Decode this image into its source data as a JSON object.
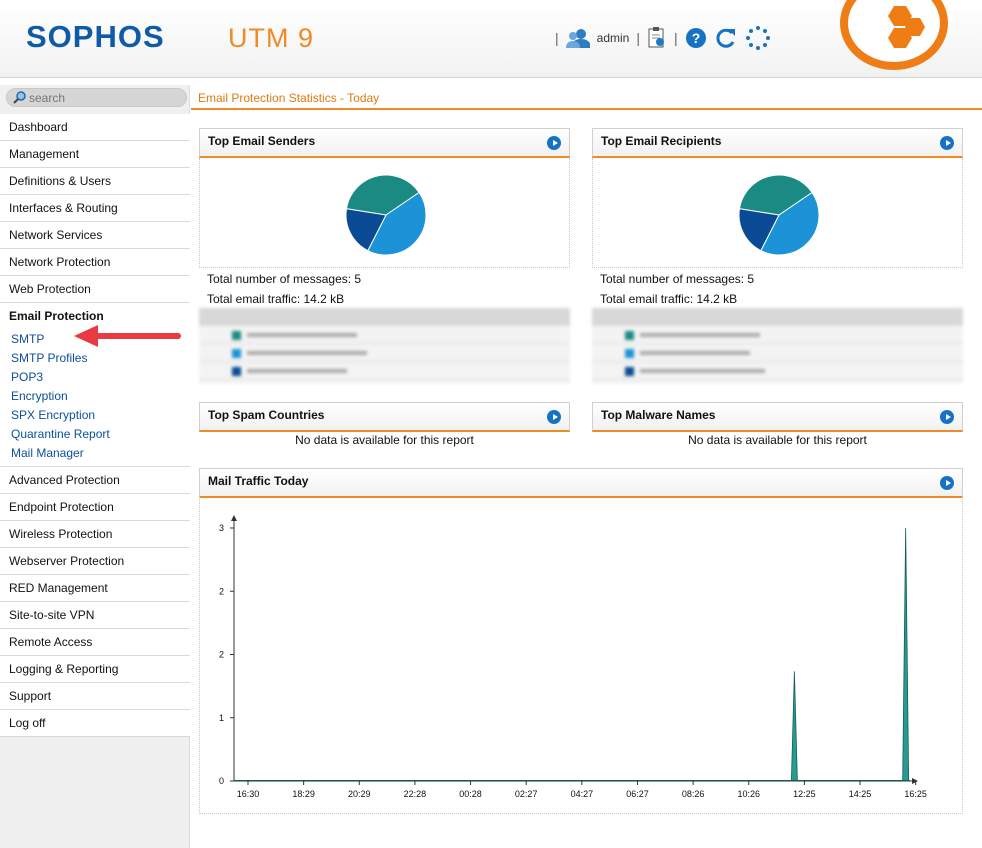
{
  "header": {
    "logo": "SOPHOS",
    "product": "UTM 9",
    "user": "admin"
  },
  "search": {
    "placeholder": "search"
  },
  "nav": {
    "items_top": [
      "Dashboard",
      "Management",
      "Definitions & Users",
      "Interfaces & Routing",
      "Network Services",
      "Network Protection",
      "Web Protection"
    ],
    "active": "Email Protection",
    "subitems": [
      "SMTP",
      "SMTP Profiles",
      "POP3",
      "Encryption",
      "SPX Encryption",
      "Quarantine Report",
      "Mail Manager"
    ],
    "items_bottom": [
      "Advanced Protection",
      "Endpoint Protection",
      "Wireless Protection",
      "Webserver Protection",
      "RED Management",
      "Site-to-site VPN",
      "Remote Access",
      "Logging & Reporting",
      "Support",
      "Log off"
    ]
  },
  "main": {
    "title": "Email Protection Statistics - Today"
  },
  "panels": {
    "senders": {
      "title": "Top Email Senders",
      "total_messages": "Total number of messages: 5",
      "total_traffic": "Total email traffic: 14.2 kB"
    },
    "recipients": {
      "title": "Top Email Recipients",
      "total_messages": "Total number of messages: 5",
      "total_traffic": "Total email traffic: 14.2 kB"
    },
    "spam": {
      "title": "Top Spam Countries",
      "message": "No data is available for this report"
    },
    "malware": {
      "title": "Top Malware Names",
      "message": "No data is available for this report"
    },
    "traffic": {
      "title": "Mail Traffic Today"
    }
  },
  "colors": {
    "accent": "#ef8a24",
    "link": "#0d4f9a",
    "pie_teal": "#1a8a82",
    "pie_blue": "#1b93d6",
    "pie_navy": "#0b4a94"
  },
  "chart_data": [
    {
      "type": "pie",
      "series": [
        {
          "values": [
            0.38,
            0.42,
            0.2
          ]
        }
      ]
    },
    {
      "type": "pie",
      "series": [
        {
          "values": [
            0.38,
            0.42,
            0.2
          ]
        }
      ]
    },
    {
      "type": "area",
      "x_labels": [
        "16:30",
        "18:29",
        "20:29",
        "22:28",
        "00:28",
        "02:27",
        "04:27",
        "06:27",
        "08:26",
        "10:26",
        "12:25",
        "14:25",
        "16:25"
      ],
      "y_labels": [
        "3",
        "2",
        "2",
        "1",
        "0"
      ],
      "ylim": [
        0,
        3
      ],
      "spikes": [
        {
          "at": "12:25",
          "peak": 1.3
        },
        {
          "at": "16:25",
          "peak": 3
        }
      ]
    }
  ]
}
